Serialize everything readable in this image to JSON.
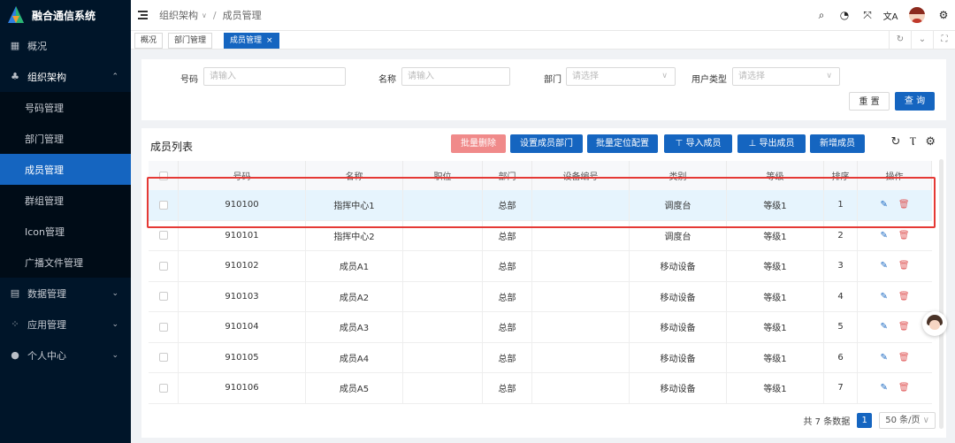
{
  "app": {
    "title": "融合通信系统"
  },
  "sidebar": {
    "items": [
      {
        "label": "概况",
        "icon": "grid-icon"
      },
      {
        "label": "组织架构",
        "icon": "org-icon",
        "open": true,
        "children": [
          {
            "label": "号码管理"
          },
          {
            "label": "部门管理"
          },
          {
            "label": "成员管理",
            "active": true
          },
          {
            "label": "群组管理"
          },
          {
            "label": "Icon管理"
          },
          {
            "label": "广播文件管理"
          }
        ]
      },
      {
        "label": "数据管理",
        "icon": "data-icon"
      },
      {
        "label": "应用管理",
        "icon": "apps-icon"
      },
      {
        "label": "个人中心",
        "icon": "user-icon"
      }
    ]
  },
  "header": {
    "breadcrumb": [
      "组织架构",
      "成员管理"
    ]
  },
  "tabs": [
    {
      "label": "概况"
    },
    {
      "label": "部门管理"
    },
    {
      "label": "成员管理",
      "active": true,
      "close": "×"
    }
  ],
  "filter": {
    "number_label": "号码",
    "number_placeholder": "请输入",
    "name_label": "名称",
    "name_placeholder": "请输入",
    "dept_label": "部门",
    "dept_placeholder": "请选择",
    "usertype_label": "用户类型",
    "usertype_placeholder": "请选择",
    "reset": "重 置",
    "search": "查 询"
  },
  "table": {
    "title": "成员列表",
    "buttons": {
      "batch_delete": "批量删除",
      "set_dept": "设置成员部门",
      "batch_locate": "批量定位配置",
      "import": "导入成员",
      "export": "导出成员",
      "add": "新增成员"
    },
    "columns": [
      "号码",
      "名称",
      "职位",
      "部门",
      "设备编号",
      "类别",
      "等级",
      "排序",
      "操作"
    ],
    "rows": [
      {
        "number": "910100",
        "name": "指挥中心1",
        "position": "",
        "dept": "总部",
        "device": "",
        "category": "调度台",
        "level": "等级1",
        "order": "1"
      },
      {
        "number": "910101",
        "name": "指挥中心2",
        "position": "",
        "dept": "总部",
        "device": "",
        "category": "调度台",
        "level": "等级1",
        "order": "2"
      },
      {
        "number": "910102",
        "name": "成员A1",
        "position": "",
        "dept": "总部",
        "device": "",
        "category": "移动设备",
        "level": "等级1",
        "order": "3"
      },
      {
        "number": "910103",
        "name": "成员A2",
        "position": "",
        "dept": "总部",
        "device": "",
        "category": "移动设备",
        "level": "等级1",
        "order": "4"
      },
      {
        "number": "910104",
        "name": "成员A3",
        "position": "",
        "dept": "总部",
        "device": "",
        "category": "移动设备",
        "level": "等级1",
        "order": "5"
      },
      {
        "number": "910105",
        "name": "成员A4",
        "position": "",
        "dept": "总部",
        "device": "",
        "category": "移动设备",
        "level": "等级1",
        "order": "6"
      },
      {
        "number": "910106",
        "name": "成员A5",
        "position": "",
        "dept": "总部",
        "device": "",
        "category": "移动设备",
        "level": "等级1",
        "order": "7"
      }
    ]
  },
  "pager": {
    "total": "共 7 条数据",
    "page": "1",
    "size": "50 条/页"
  },
  "colors": {
    "primary": "#1565c0",
    "sidebar": "#001529",
    "danger": "#e53935"
  }
}
